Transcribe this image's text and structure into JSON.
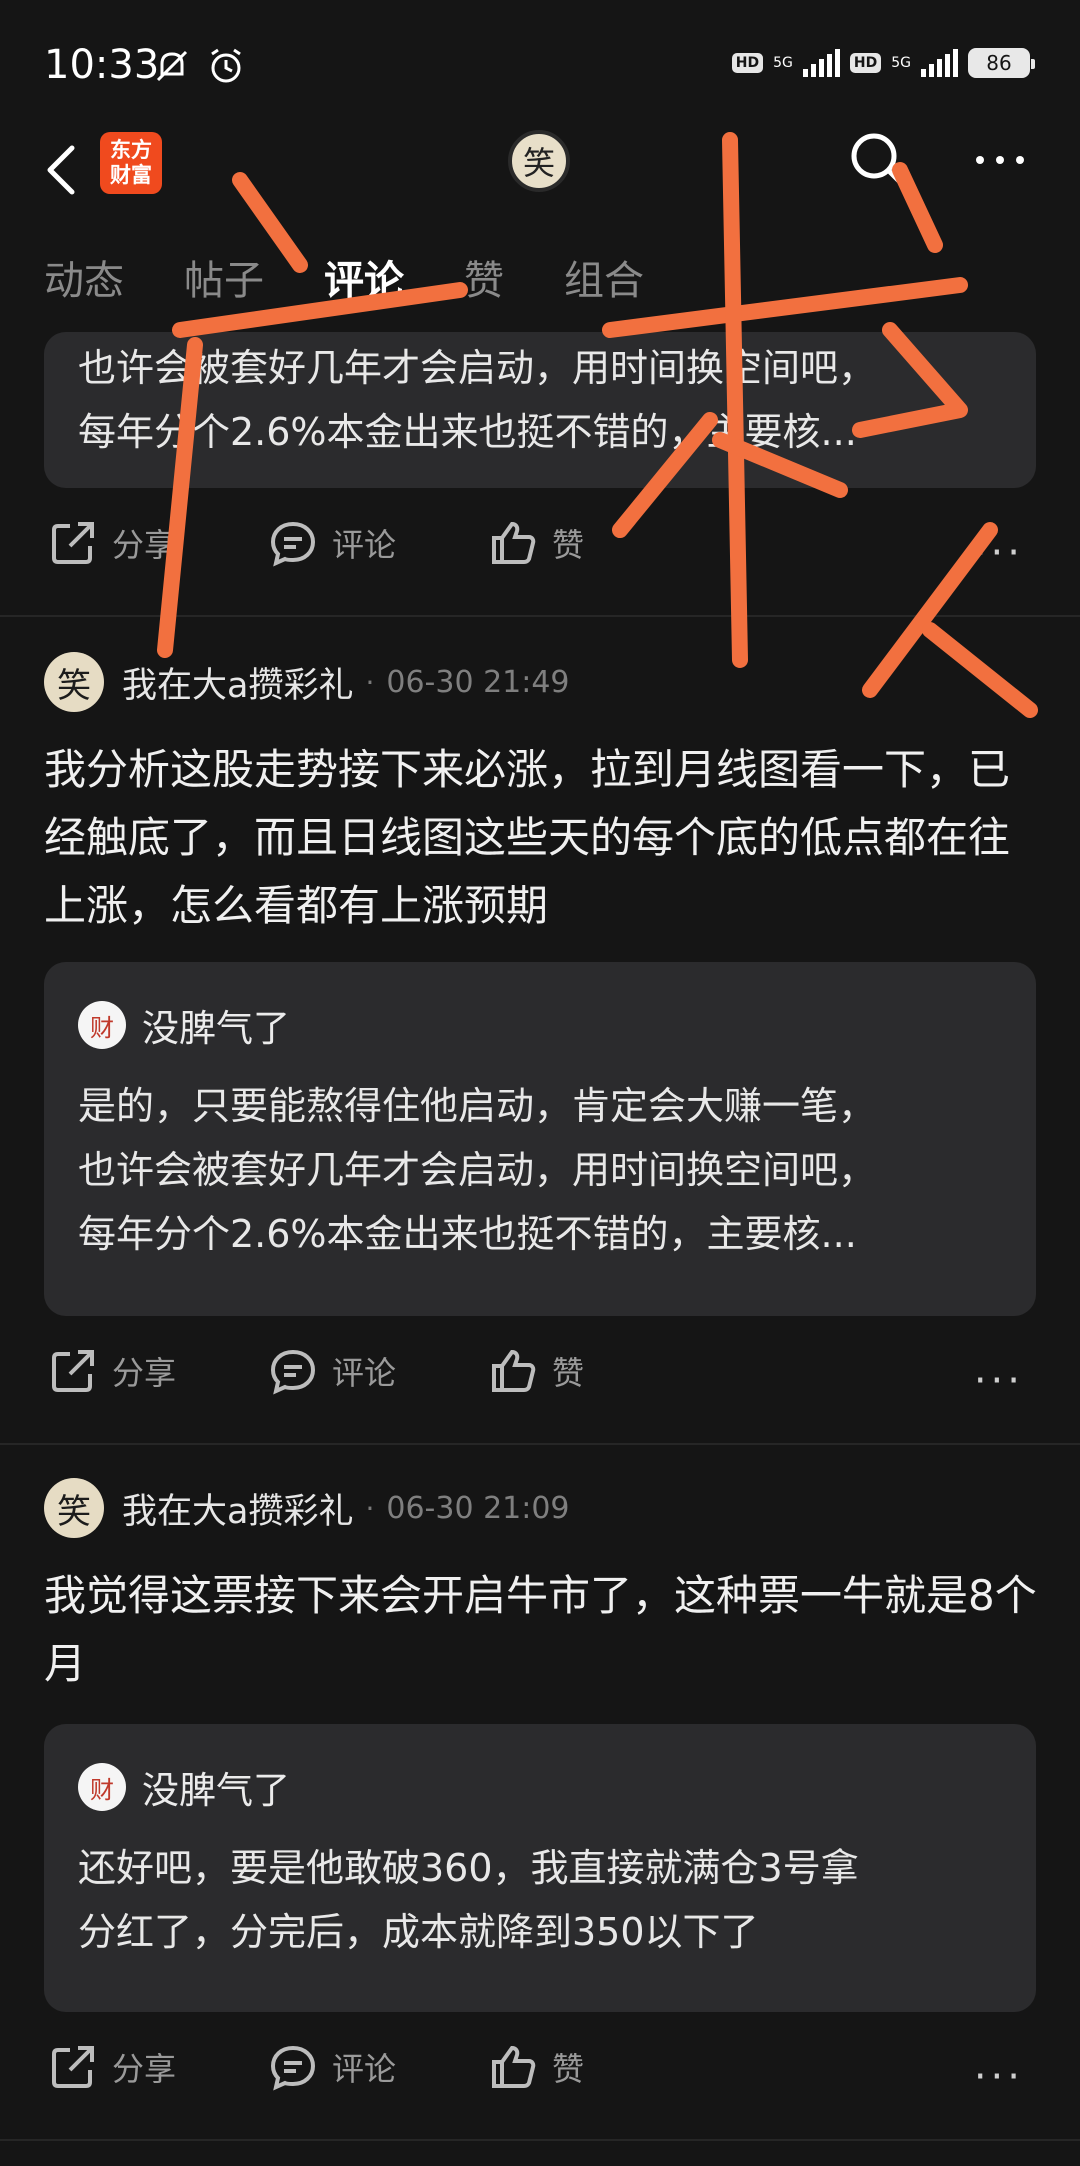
{
  "status_bar": {
    "time": "10:33",
    "network_1": "5G",
    "network_2": "5G",
    "hd": "HD",
    "battery": "86"
  },
  "nav": {
    "app_logo_text": "东方财富",
    "center_avatar_glyph": "笑"
  },
  "tabs": [
    {
      "label": "动态"
    },
    {
      "label": "帖子"
    },
    {
      "label": "评论"
    },
    {
      "label": "赞"
    },
    {
      "label": "组合"
    }
  ],
  "active_tab": "评论",
  "top_card": {
    "lines": [
      "也许会被套好几年才会启动，用时间换空间吧，",
      "每年分个2.6%本金出来也挺不错的，主要核..."
    ]
  },
  "actions": {
    "share": "分享",
    "comment": "评论",
    "like": "赞",
    "more": "···"
  },
  "posts": [
    {
      "author": "我在大a攒彩礼",
      "avatar_glyph": "笑",
      "time": "06-30 21:49",
      "text": "我分析这股走势接下来必涨，拉到月线图看一下，已经触底了，而且日线图这些天的每个底的低点都在往上涨，怎么看都有上涨预期",
      "reply": {
        "name": "没脾气了",
        "avatar_glyph": "财",
        "lines": [
          "是的，只要能熬得住他启动，肯定会大赚一笔，",
          "也许会被套好几年才会启动，用时间换空间吧，",
          "每年分个2.6%本金出来也挺不错的，主要核..."
        ]
      }
    },
    {
      "author": "我在大a攒彩礼",
      "avatar_glyph": "笑",
      "time": "06-30 21:09",
      "text": "我觉得这票接下来会开启牛市了，这种票一牛就是8个月",
      "reply": {
        "name": "没脾气了",
        "avatar_glyph": "财",
        "lines": [
          "还好吧，要是他敢破360，我直接就满仓3号拿",
          "分红了，分完后，成本就降到350以下了"
        ]
      }
    }
  ],
  "colors": {
    "background": "#151515",
    "card": "#2b2b2d",
    "scribble": "#f2703f",
    "brand": "#f04a1e"
  }
}
